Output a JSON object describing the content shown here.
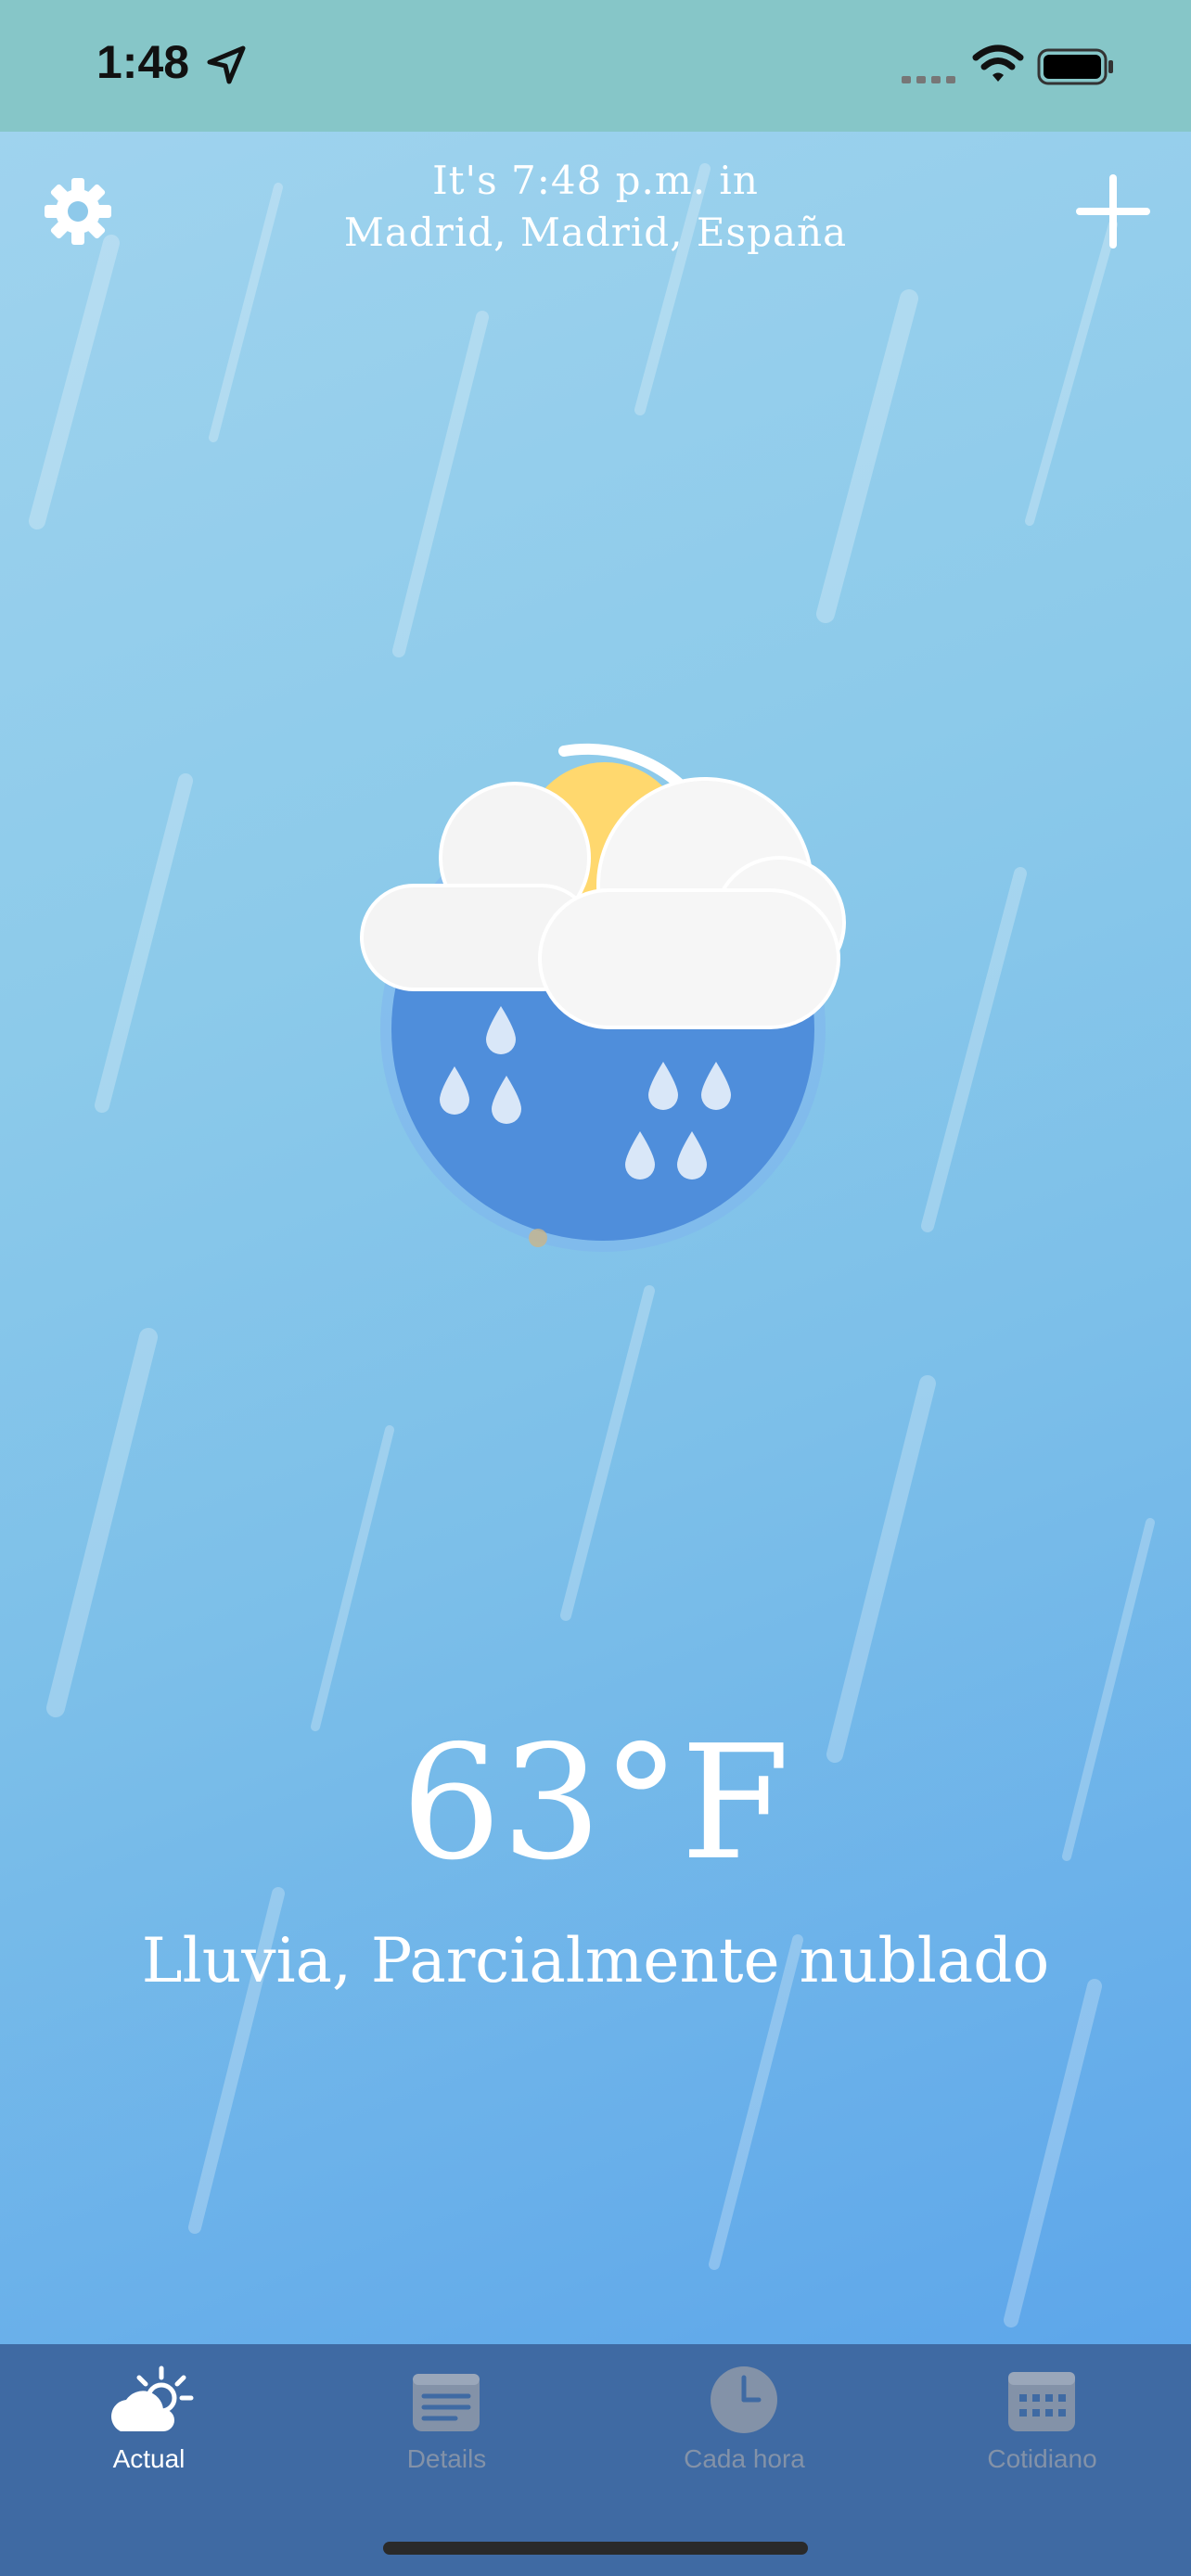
{
  "status_bar": {
    "time": "1:48",
    "icons": [
      "location-arrow-icon",
      "signal-icon",
      "wifi-icon",
      "battery-icon"
    ]
  },
  "header": {
    "line1": "It's 7:48 p.m. in",
    "line2": "Madrid, Madrid, España",
    "settings_icon": "gear-icon",
    "add_icon": "plus-icon"
  },
  "current": {
    "temperature": "63°F",
    "condition": "Lluvia, Parcialmente nublado",
    "icon": "rain-partly-cloudy-icon"
  },
  "tabs": [
    {
      "label": "Actual",
      "icon": "cloud-sun-icon",
      "active": true
    },
    {
      "label": "Details",
      "icon": "details-icon",
      "active": false
    },
    {
      "label": "Cada hora",
      "icon": "clock-icon",
      "active": false
    },
    {
      "label": "Cotidiano",
      "icon": "calendar-icon",
      "active": false
    }
  ],
  "colors": {
    "status_bar_bg": "#86c6c8",
    "tab_bar_bg": "#3f6aa3",
    "tab_active": "#ffffff",
    "tab_inactive": "#8392a8",
    "sun": "#ffd86e",
    "rain_disc": "#4f8edb"
  }
}
